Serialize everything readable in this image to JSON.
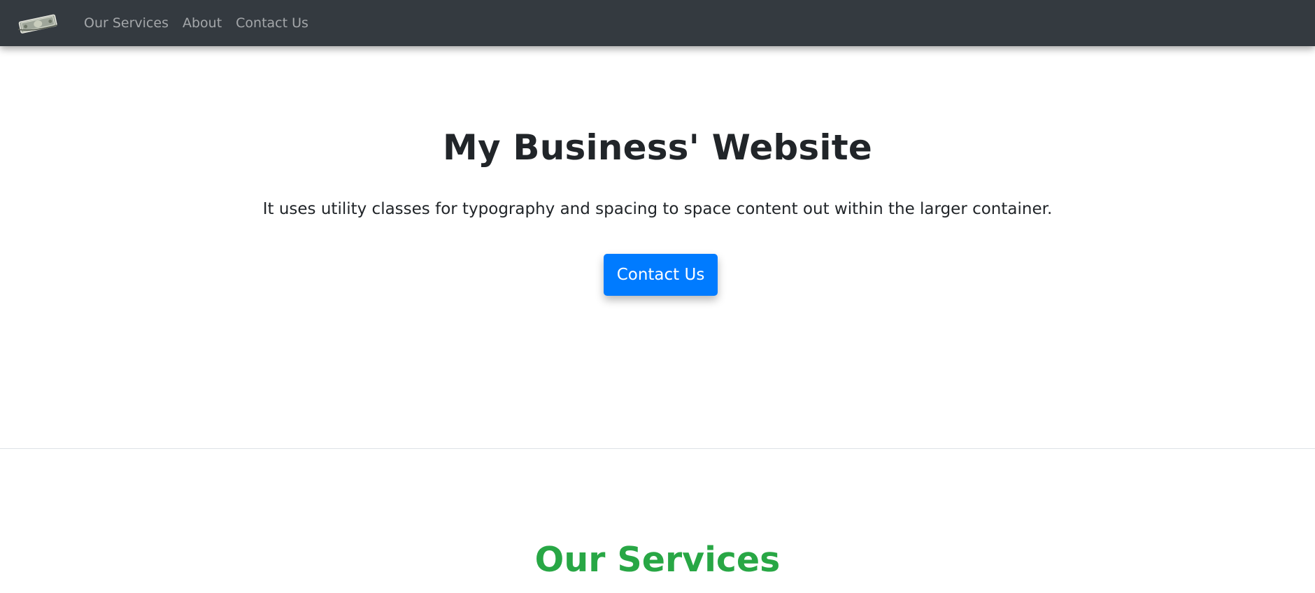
{
  "navbar": {
    "logo_icon": "money-bill-icon",
    "links": [
      {
        "label": "Our Services"
      },
      {
        "label": "About"
      },
      {
        "label": "Contact Us"
      }
    ],
    "background": "#343a40",
    "link_color": "rgba(255,255,255,0.55)"
  },
  "hero": {
    "title": "My Business' Website",
    "lead": "It uses utility classes for typography and spacing to space content out within the larger container.",
    "cta_label": "Contact Us",
    "cta_color": "#007bff"
  },
  "services": {
    "title": "Our Services",
    "title_color": "#28a745"
  }
}
